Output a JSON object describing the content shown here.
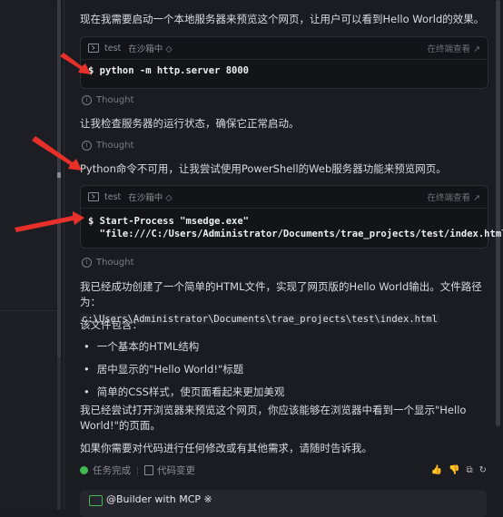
{
  "messages": {
    "intro": "现在我需要启动一个本地服务器来预览这个网页，让用户可以看到Hello World的效果。",
    "check_server": "让我检查服务器的运行状态，确保它正常启动。",
    "python_unavailable": "Python命令不可用，让我尝试使用PowerShell的Web服务器功能来预览网页。",
    "created": "我已经成功创建了一个简单的HTML文件，实现了网页版的Hello World输出。文件路径为：",
    "file_path": "c:\\Users\\Administrator\\Documents\\trae_projects\\test\\index.html",
    "contains": "该文件包含：",
    "bullets": [
      "一个基本的HTML结构",
      "居中显示的\"Hello World!\"标题",
      "简单的CSS样式，使页面看起来更加美观"
    ],
    "opened": "我已经尝试打开浏览器来预览这个网页，你应该能够在浏览器中看到一个显示\"Hello World!\"的页面。",
    "closing": "如果你需要对代码进行任何修改或有其他需求，请随时告诉我。"
  },
  "thought_label": "Thought",
  "terminal": {
    "name": "test",
    "sandbox": "在沙箱中 ◇",
    "open_in_terminal": "在终端查看 ↗",
    "cmd1": "$ python -m http.server 8000",
    "cmd2_line1": "$ Start-Process \"msedge.exe\"",
    "cmd2_line2": "  \"file:///C:/Users/Administrator/Documents/trae_projects/test/index.html\""
  },
  "footer": {
    "task_done": "任务完成",
    "code_changes": "代码变更",
    "icons": [
      "thumbs-up-icon",
      "thumbs-down-icon",
      "copy-icon",
      "refresh-icon"
    ]
  },
  "builder_label": "@Builder with MCP ※",
  "colors": {
    "accent_green": "#3fb950",
    "annotation_red": "#e8302a"
  }
}
